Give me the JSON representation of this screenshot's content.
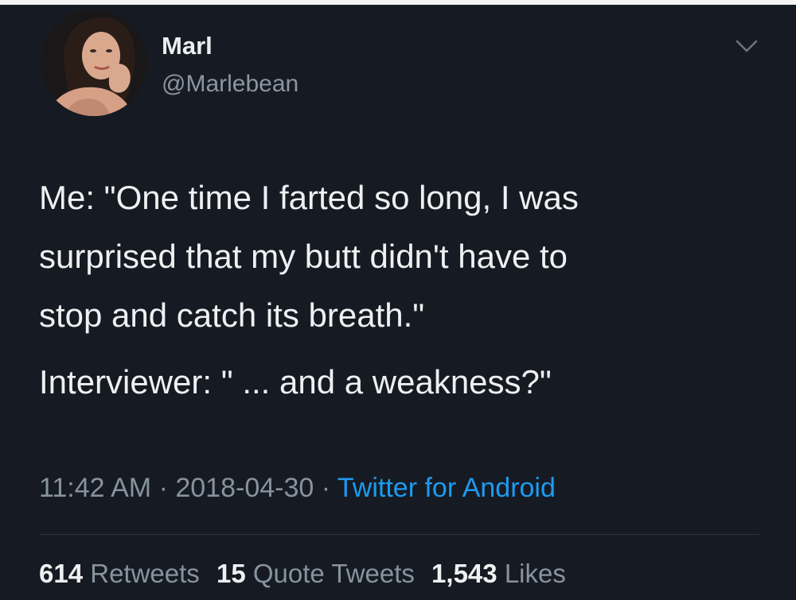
{
  "tweet": {
    "author": {
      "display_name": "Marl",
      "handle": "@Marlebean",
      "avatar": "profile-photo"
    },
    "menu_icon": "chevron-down-icon",
    "body": {
      "line1": "Me: \"One time I farted so long, I was",
      "line2": "surprised that my butt didn't have to",
      "line3": "stop and catch its breath.\"",
      "line4": "Interviewer: \" ... and a weakness?\""
    },
    "meta": {
      "time": "11:42 AM",
      "separator": " · ",
      "date": "2018-04-30",
      "source": "Twitter for Android"
    },
    "stats": {
      "retweets_count": "614",
      "retweets_label": "Retweets",
      "quotes_count": "15",
      "quotes_label": "Quote Tweets",
      "likes_count": "1,543",
      "likes_label": "Likes"
    },
    "colors": {
      "background": "#161b23",
      "text": "#eef0f2",
      "secondary": "#87939d",
      "link": "#1d9bf0"
    }
  }
}
